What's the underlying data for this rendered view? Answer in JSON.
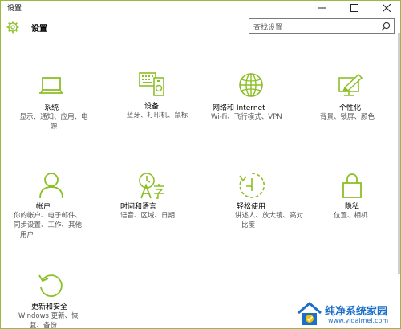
{
  "window": {
    "title": "设置"
  },
  "header": {
    "app_title": "设置",
    "search_placeholder": "查找设置"
  },
  "colors": {
    "accent": "#8cbf26",
    "border": "#9ab844",
    "text": "#000000",
    "subtext": "#555555"
  },
  "tiles": [
    {
      "icon": "laptop-icon",
      "name": "系统",
      "desc": [
        "显示、通知、应用、电",
        "源"
      ]
    },
    {
      "icon": "devices-icon",
      "name": "设备",
      "desc": [
        "蓝牙、打印机、鼠标"
      ]
    },
    {
      "icon": "globe-icon",
      "name": "网络和 Internet",
      "desc": [
        "Wi-Fi、飞行模式、VPN"
      ]
    },
    {
      "icon": "personalization-icon",
      "name": "个性化",
      "desc": [
        "背景、锁屏、颜色"
      ]
    },
    {
      "icon": "person-icon",
      "name": "帐户",
      "desc": [
        "你的帐户、电子邮件、",
        "同步设置、工作、其他",
        "用户"
      ]
    },
    {
      "icon": "time-language-icon",
      "name": "时间和语言",
      "desc": [
        "语音、区域、日期"
      ]
    },
    {
      "icon": "ease-of-access-icon",
      "name": "轻松使用",
      "desc": [
        "讲述人、放大镜、高对",
        "比度"
      ]
    },
    {
      "icon": "lock-icon",
      "name": "隐私",
      "desc": [
        "位置、相机"
      ]
    },
    {
      "icon": "refresh-icon",
      "name": "更新和安全",
      "desc": [
        "Windows 更新、恢",
        "复、备份"
      ]
    }
  ],
  "watermark": {
    "title": "纯净系统家园",
    "url": "www.yidaimei.com"
  }
}
